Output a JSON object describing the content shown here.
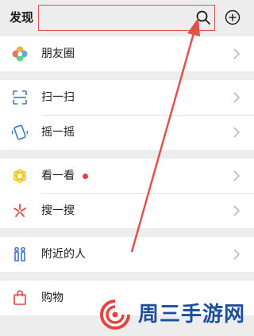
{
  "header": {
    "title": "发现",
    "search_placeholder": ""
  },
  "groups": [
    {
      "items": [
        {
          "label": "朋友圈",
          "icon": "moments-icon"
        }
      ]
    },
    {
      "items": [
        {
          "label": "扫一扫",
          "icon": "scan-icon"
        },
        {
          "label": "摇一摇",
          "icon": "shake-icon"
        }
      ]
    },
    {
      "items": [
        {
          "label": "看一看",
          "icon": "top-stories-icon",
          "badge": "red-dot"
        },
        {
          "label": "搜一搜",
          "icon": "search-sparkle-icon"
        }
      ]
    },
    {
      "items": [
        {
          "label": "附近的人",
          "icon": "people-nearby-icon"
        }
      ]
    },
    {
      "items": [
        {
          "label": "购物",
          "icon": "shopping-bag-icon"
        }
      ]
    }
  ],
  "watermark": {
    "text": "周三手游网"
  },
  "colors": {
    "accent_red": "#e64340",
    "annotation": "#e0524e",
    "watermark": "#1e4f9e"
  }
}
